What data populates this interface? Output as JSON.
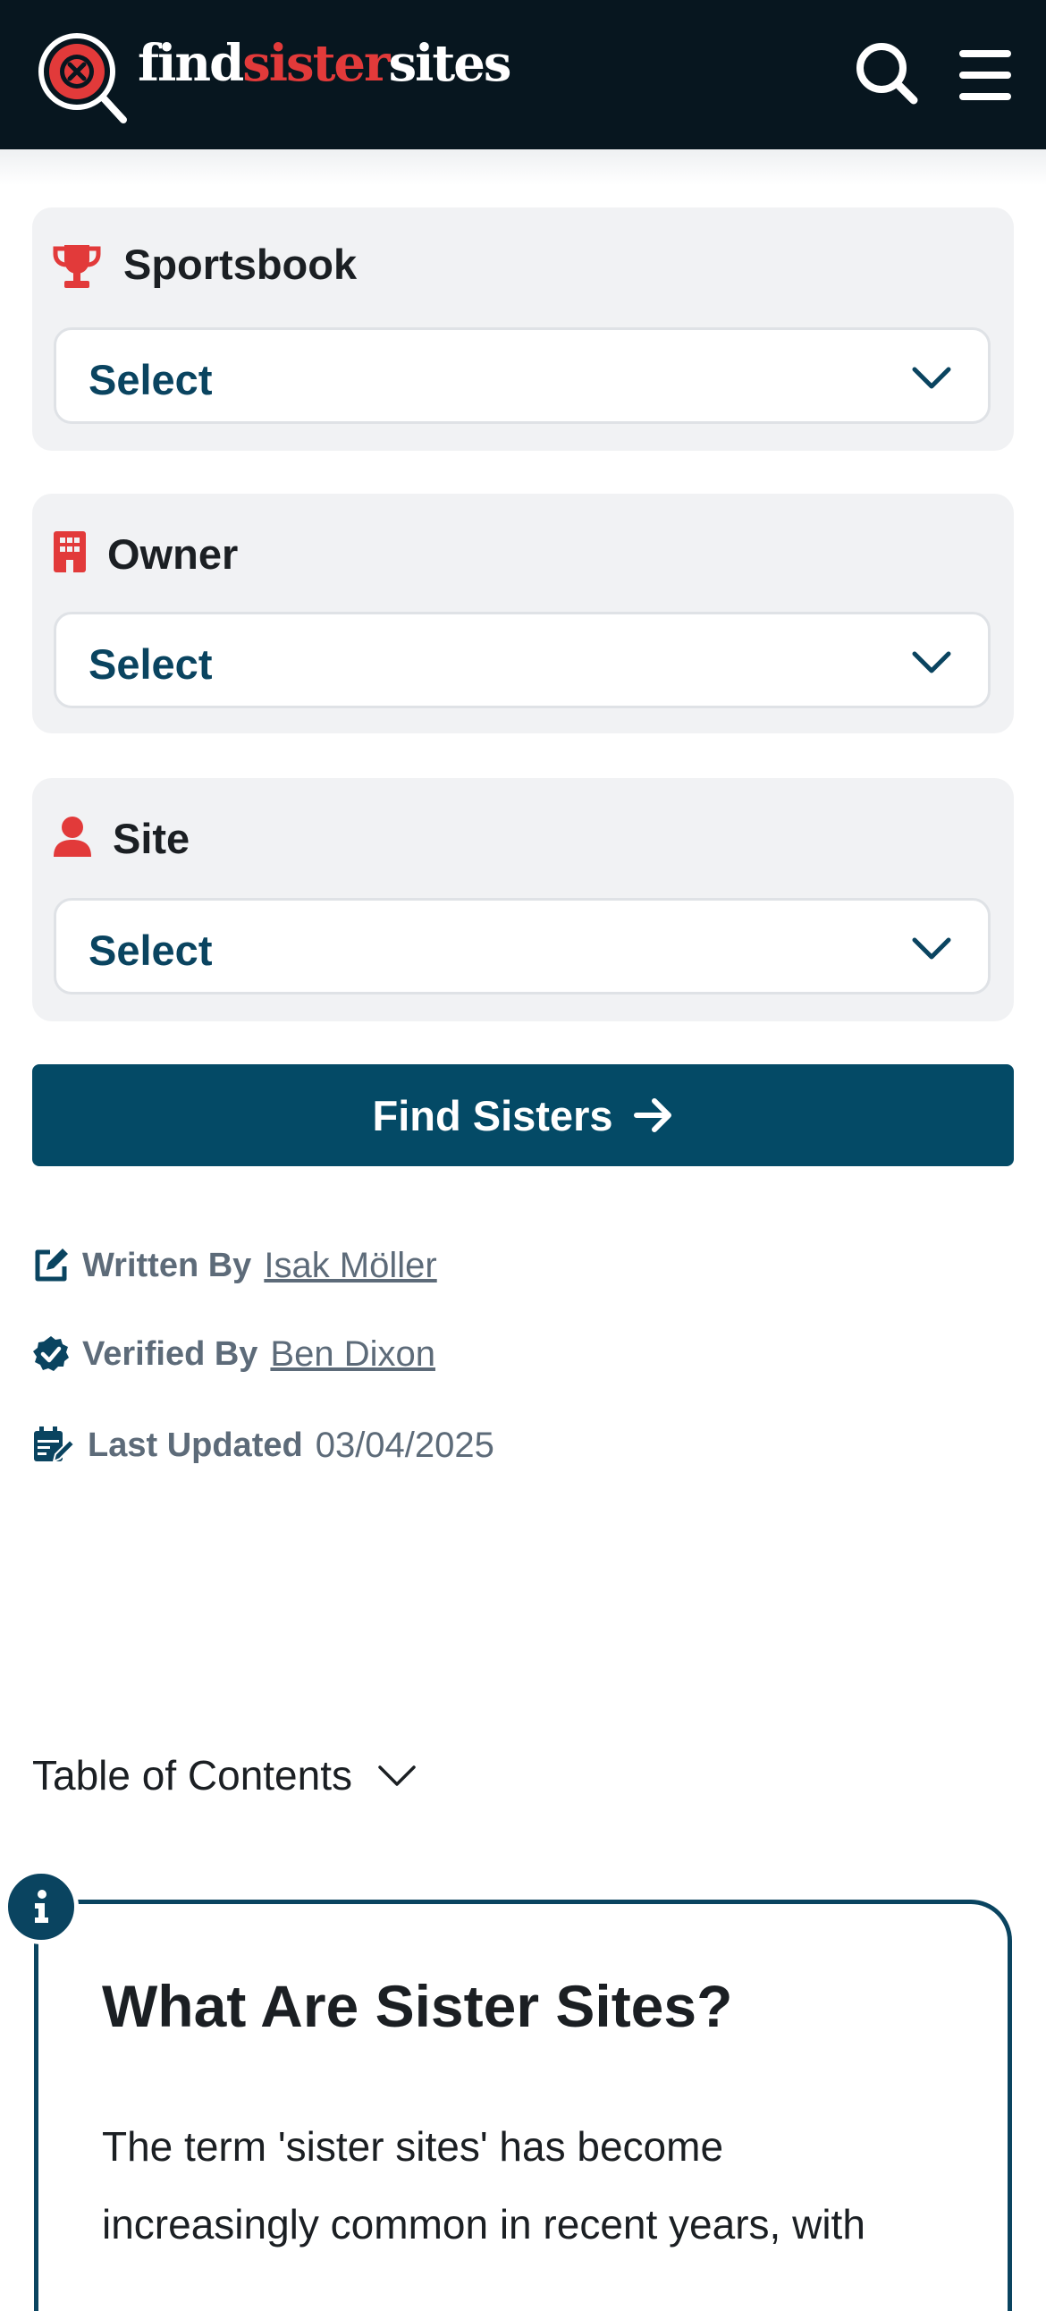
{
  "header": {
    "logo_prefix": "find",
    "logo_highlight": "sister",
    "logo_suffix": "sites",
    "search_icon": "search-icon",
    "menu_icon": "hamburger-menu-icon"
  },
  "filters": [
    {
      "label": "Sportsbook",
      "icon": "trophy-icon",
      "value": "Select"
    },
    {
      "label": "Owner",
      "icon": "building-icon",
      "value": "Select"
    },
    {
      "label": "Site",
      "icon": "user-icon",
      "value": "Select"
    }
  ],
  "find_button": {
    "label": "Find Sisters",
    "icon": "arrow-right-icon"
  },
  "meta": {
    "written_label": "Written By",
    "written_name": "Isak Möller",
    "verified_label": "Verified By",
    "verified_name": "Ben Dixon",
    "updated_label": "Last Updated",
    "updated_date": "03/04/2025"
  },
  "toc": {
    "label": "Table of Contents"
  },
  "info": {
    "title": "What Are Sister Sites?",
    "body_line1": "The term 'sister sites' has become",
    "body_line2": "increasingly common in recent years, with"
  },
  "colors": {
    "header_bg": "#07161f",
    "accent_red": "#e23a3a",
    "primary_blue": "#044a66",
    "card_bg": "#f1f2f4",
    "meta_gray": "#5d6b79"
  }
}
